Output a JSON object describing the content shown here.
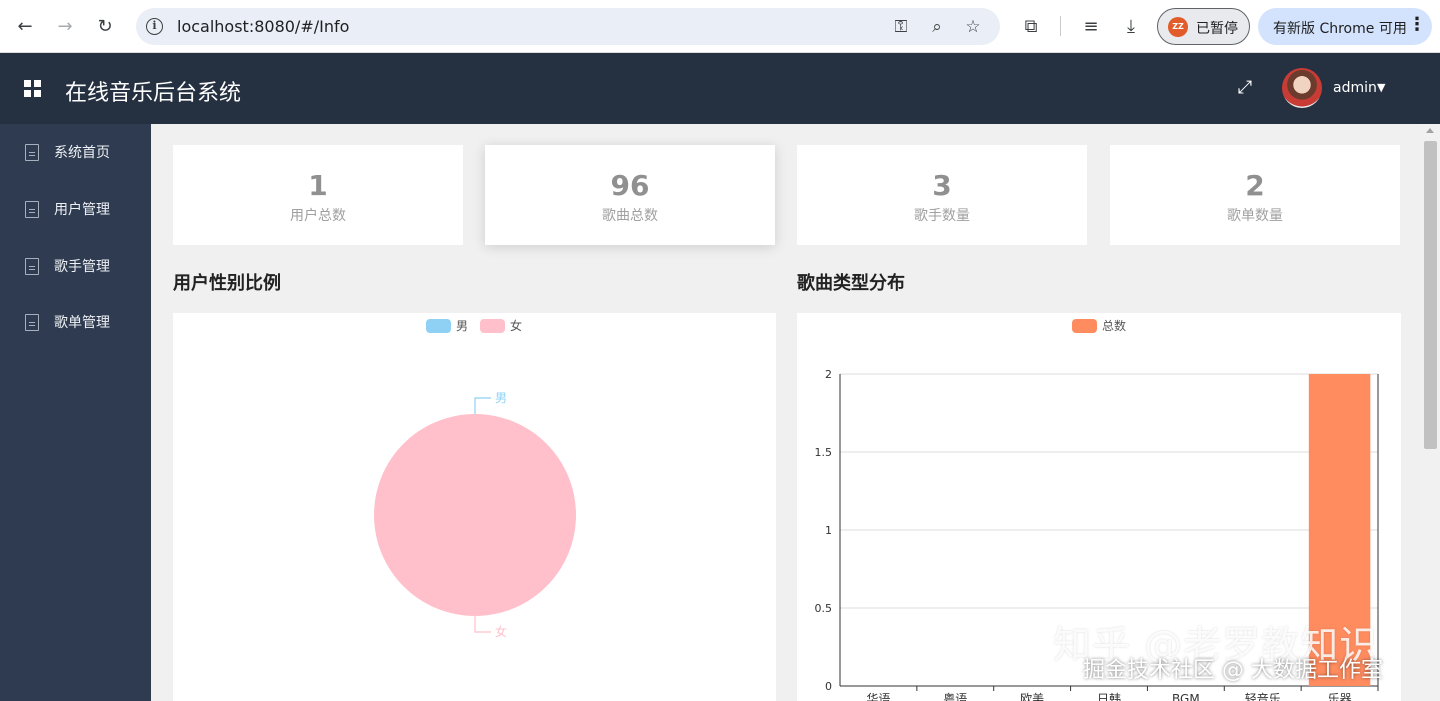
{
  "browser": {
    "url": "localhost:8080/#/Info",
    "paused_label": "已暂停",
    "profile_initials": "ZZ",
    "update_label": "有新版 Chrome 可用"
  },
  "header": {
    "title": "在线音乐后台系统",
    "username": "admin"
  },
  "sidebar": {
    "items": [
      {
        "label": "系统首页"
      },
      {
        "label": "用户管理"
      },
      {
        "label": "歌手管理"
      },
      {
        "label": "歌单管理"
      }
    ]
  },
  "stats": [
    {
      "value": "1",
      "label": "用户总数"
    },
    {
      "value": "96",
      "label": "歌曲总数"
    },
    {
      "value": "3",
      "label": "歌手数量"
    },
    {
      "value": "2",
      "label": "歌单数量"
    }
  ],
  "sections": {
    "gender_title": "用户性别比例",
    "genre_title": "歌曲类型分布"
  },
  "chart_data": [
    {
      "type": "pie",
      "title": "用户性别比例",
      "legend": [
        "男",
        "女"
      ],
      "slices": [
        {
          "name": "男",
          "value": 0,
          "color": "#8fd0f5"
        },
        {
          "name": "女",
          "value": 1,
          "color": "#ffc0cb"
        }
      ]
    },
    {
      "type": "bar",
      "title": "歌曲类型分布",
      "legend": [
        "总数"
      ],
      "color": "#ff8c5f",
      "categories": [
        "华语",
        "粤语",
        "欧美",
        "日韩",
        "BGM",
        "轻音乐",
        "乐器"
      ],
      "series": [
        {
          "name": "总数",
          "values": [
            0,
            0,
            0,
            0,
            0,
            0,
            2
          ]
        }
      ],
      "ylim": [
        0,
        2
      ],
      "yticks": [
        "0",
        "0.5",
        "1",
        "1.5",
        "2"
      ],
      "grid": true
    }
  ],
  "watermark": {
    "line1": "知乎 @老罗教知识",
    "line2": "掘金技术社区 @ 大数据工作室"
  }
}
